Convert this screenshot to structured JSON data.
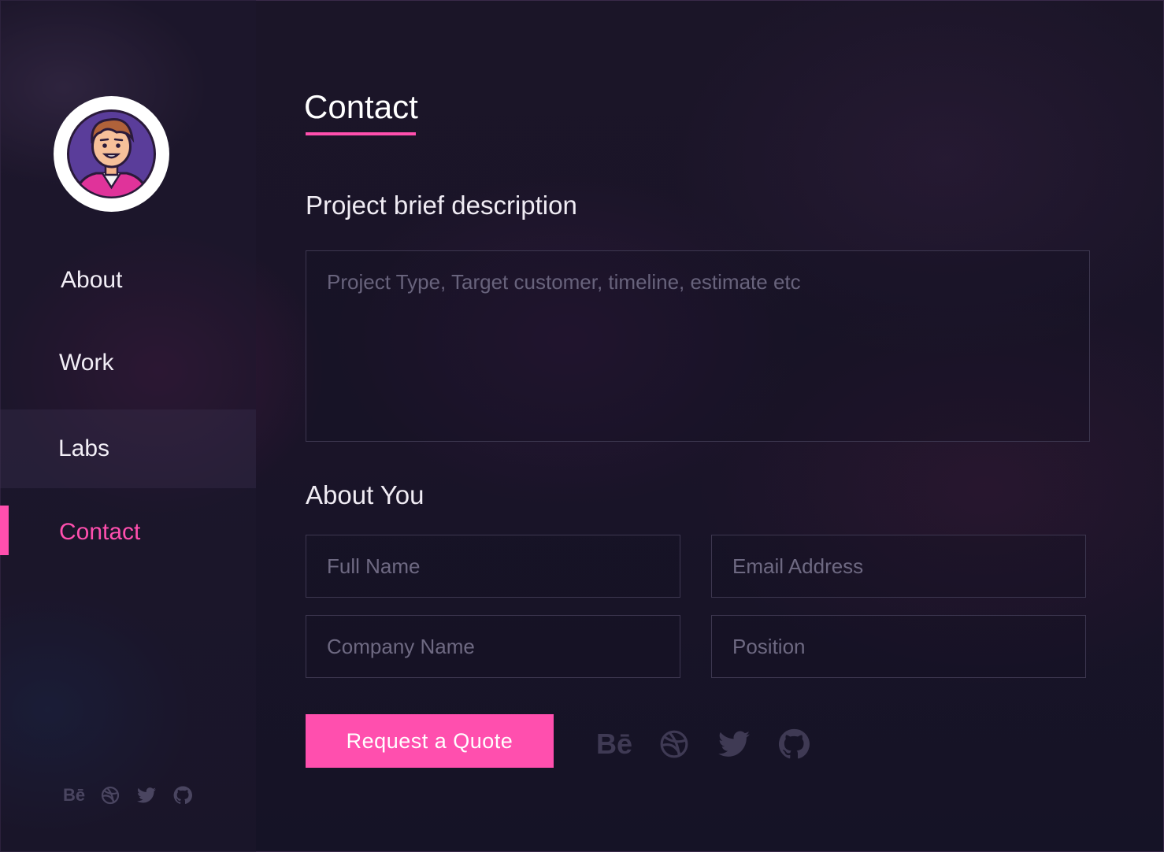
{
  "nav": {
    "items": [
      {
        "label": "About"
      },
      {
        "label": "Work"
      },
      {
        "label": "Labs"
      },
      {
        "label": "Contact"
      }
    ],
    "active": "Contact"
  },
  "page": {
    "title": "Contact"
  },
  "form": {
    "project_label": "Project brief description",
    "project_placeholder": "Project Type, Target customer, timeline, estimate etc",
    "about_label": "About You",
    "full_name_placeholder": "Full Name",
    "email_placeholder": "Email Address",
    "company_placeholder": "Company Name",
    "position_placeholder": "Position",
    "submit_label": "Request a Quote"
  },
  "social": {
    "behance": "Bē",
    "icons": [
      "behance-icon",
      "dribbble-icon",
      "twitter-icon",
      "github-icon"
    ]
  },
  "colors": {
    "accent": "#ff4fae",
    "background": "#171326",
    "icon_muted": "#3f3a54"
  }
}
